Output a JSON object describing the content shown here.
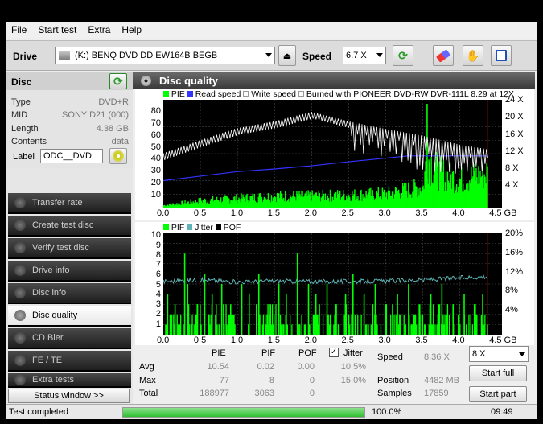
{
  "menu": {
    "items": [
      "File",
      "Start test",
      "Extra",
      "Help"
    ]
  },
  "toolbar": {
    "drive_label": "Drive",
    "drive_value": "(K:)  BENQ DVD DD EW164B BEGB",
    "speed_label": "Speed",
    "speed_value": "6.7 X"
  },
  "disc": {
    "header": "Disc",
    "type_label": "Type",
    "type_value": "DVD+R",
    "mid_label": "MID",
    "mid_value": "SONY D21 (000)",
    "length_label": "Length",
    "length_value": "4.38 GB",
    "contents_label": "Contents",
    "contents_value": "data",
    "label_label": "Label",
    "label_value": "ODC__DVD"
  },
  "nav": {
    "items": [
      "Transfer rate",
      "Create test disc",
      "Verify test disc",
      "Drive info",
      "Disc info",
      "Disc quality",
      "CD Bler",
      "FE / TE",
      "Extra tests"
    ],
    "active": "Disc quality",
    "status_window": "Status window >>"
  },
  "panel": {
    "title": "Disc quality"
  },
  "colors": {
    "pie": "#00ff00",
    "read": "#3333ff",
    "write": "#ffffff",
    "pif": "#00ff00",
    "jitter": "#5fb5b5",
    "pof": "#000000"
  },
  "chart_data": [
    {
      "type": "bar",
      "legend": [
        "PIE",
        "Read speed",
        "Write speed",
        "Burned with PIONEER DVD-RW  DVR-111L 8.29 at 12X"
      ],
      "x_ticks": [
        "0.0",
        "0.5",
        "1.0",
        "1.5",
        "2.0",
        "2.5",
        "3.0",
        "3.5",
        "4.0",
        "4.5 GB"
      ],
      "y_ticks": [
        "80",
        "70",
        "60",
        "50",
        "40",
        "30",
        "20",
        "10"
      ],
      "y2_ticks": [
        "24 X",
        "20 X",
        "16 X",
        "12 X",
        "8 X",
        "4 X"
      ],
      "xlim": [
        0,
        4.5
      ],
      "ylim": [
        0,
        80
      ],
      "pie_envelope": [
        [
          0,
          2
        ],
        [
          0.25,
          4
        ],
        [
          0.5,
          6
        ],
        [
          1.0,
          8
        ],
        [
          1.5,
          10
        ],
        [
          2.0,
          10
        ],
        [
          2.5,
          11
        ],
        [
          3.0,
          12
        ],
        [
          3.5,
          18
        ],
        [
          3.55,
          45
        ],
        [
          3.7,
          30
        ],
        [
          4.0,
          24
        ],
        [
          4.37,
          30
        ]
      ],
      "read_speed": [
        [
          0,
          6
        ],
        [
          0.5,
          7
        ],
        [
          1.0,
          8
        ],
        [
          1.5,
          8.6
        ],
        [
          2.0,
          9.3
        ],
        [
          2.5,
          10.2
        ],
        [
          3.0,
          11
        ],
        [
          3.3,
          11.5
        ],
        [
          4.37,
          11.5
        ]
      ],
      "write_speed": [
        [
          0,
          12.1
        ],
        [
          0.5,
          15
        ],
        [
          1.0,
          17.7
        ],
        [
          1.5,
          19.2
        ],
        [
          2.0,
          21.3
        ],
        [
          2.5,
          19.2
        ],
        [
          3.0,
          17.5
        ],
        [
          3.5,
          16
        ],
        [
          4.0,
          14
        ],
        [
          4.37,
          13
        ]
      ]
    },
    {
      "type": "bar",
      "legend": [
        "PIF",
        "Jitter",
        "POF"
      ],
      "x_ticks": [
        "0.0",
        "0.5",
        "1.0",
        "1.5",
        "2.0",
        "2.5",
        "3.0",
        "3.5",
        "4.0",
        "4.5 GB"
      ],
      "y_ticks": [
        "10",
        "9",
        "8",
        "7",
        "6",
        "5",
        "4",
        "3",
        "2",
        "1"
      ],
      "y2_ticks": [
        "20%",
        "16%",
        "12%",
        "8%",
        "4%"
      ],
      "xlim": [
        0,
        4.5
      ],
      "ylim": [
        0,
        10
      ],
      "pif_spikes": [
        [
          0.05,
          4
        ],
        [
          0.15,
          3
        ],
        [
          0.28,
          8
        ],
        [
          0.32,
          5
        ],
        [
          0.45,
          3
        ],
        [
          0.55,
          6
        ],
        [
          0.65,
          4
        ],
        [
          0.78,
          5
        ],
        [
          0.9,
          3
        ],
        [
          1.05,
          5
        ],
        [
          1.15,
          4
        ],
        [
          1.28,
          6
        ],
        [
          1.42,
          3
        ],
        [
          1.55,
          5
        ],
        [
          1.65,
          4
        ],
        [
          1.8,
          8
        ],
        [
          1.95,
          5
        ],
        [
          2.05,
          4
        ],
        [
          2.2,
          5
        ],
        [
          2.32,
          3
        ],
        [
          2.45,
          4
        ],
        [
          2.55,
          6
        ],
        [
          2.7,
          4
        ],
        [
          2.85,
          5
        ],
        [
          3.0,
          3
        ],
        [
          3.15,
          4
        ],
        [
          3.3,
          5
        ],
        [
          3.45,
          3
        ],
        [
          3.6,
          4
        ],
        [
          3.75,
          5
        ],
        [
          3.9,
          3
        ],
        [
          4.05,
          4
        ],
        [
          4.2,
          3
        ],
        [
          4.3,
          4
        ]
      ],
      "jitter": [
        [
          0,
          10.5
        ],
        [
          0.5,
          10.8
        ],
        [
          1.0,
          10.4
        ],
        [
          1.5,
          10.6
        ],
        [
          2.0,
          10.5
        ],
        [
          2.5,
          10.5
        ],
        [
          3.0,
          10.6
        ],
        [
          3.5,
          10.8
        ],
        [
          4.0,
          11.2
        ],
        [
          4.37,
          11.5
        ]
      ]
    }
  ],
  "stats": {
    "col_pie": "PIE",
    "col_pif": "PIF",
    "col_pof": "POF",
    "col_jitter": "Jitter",
    "avg_label": "Avg",
    "avg_pie": "10.54",
    "avg_pif": "0.02",
    "avg_pof": "0.00",
    "avg_jitter": "10.5%",
    "max_label": "Max",
    "max_pie": "77",
    "max_pif": "8",
    "max_pof": "0",
    "max_jitter": "15.0%",
    "total_label": "Total",
    "total_pie": "188977",
    "total_pif": "3063",
    "total_pof": "0",
    "speed_label": "Speed",
    "speed_value": "8.36 X",
    "position_label": "Position",
    "position_value": "4482 MB",
    "samples_label": "Samples",
    "samples_value": "17859",
    "speed_select": "8 X",
    "start_full": "Start full",
    "start_part": "Start part"
  },
  "statusbar": {
    "text": "Test completed",
    "progress": 100,
    "progress_text": "100.0%",
    "time": "09:49"
  }
}
